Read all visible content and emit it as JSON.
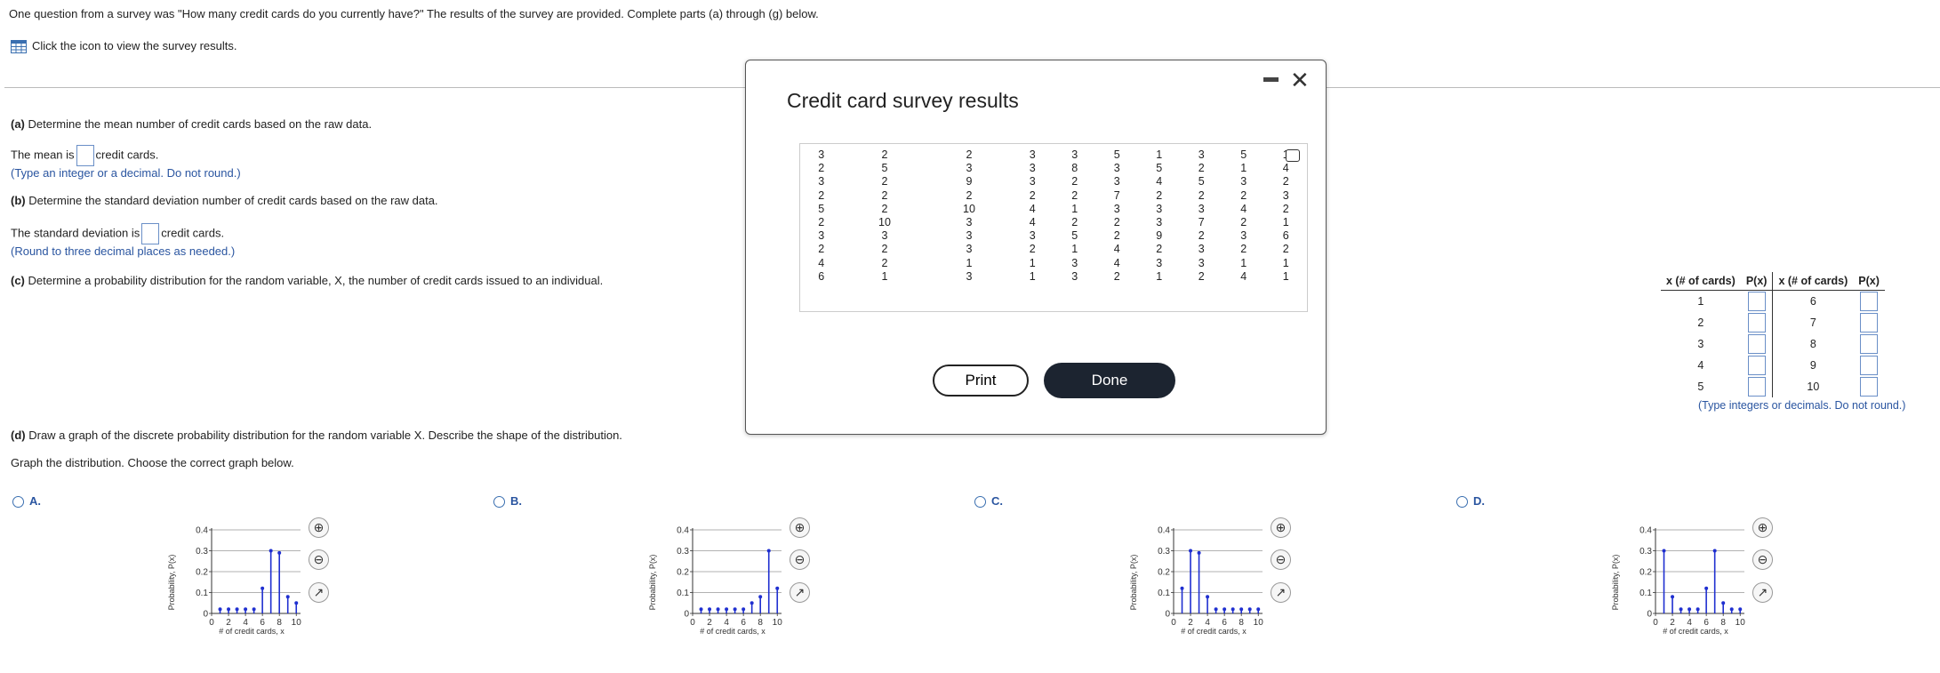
{
  "intro": {
    "question": "One question from a survey was \"How many credit cards do you currently have?\" The results of the survey are provided. Complete parts (a) through (g) below.",
    "icon_prompt": "Click the icon to view the survey results."
  },
  "part_a": {
    "heading_label": "(a)",
    "heading": " Determine the mean number of credit cards based on the raw data.",
    "answer_prefix": "The mean is",
    "answer_suffix": "credit cards.",
    "hint": "(Type an integer or a decimal. Do not round.)"
  },
  "part_b": {
    "heading_label": "(b)",
    "heading": " Determine the standard deviation number of credit cards based on the raw data.",
    "answer_prefix": "The standard deviation is",
    "answer_suffix": "credit cards.",
    "hint": "(Round to three decimal places as needed.)"
  },
  "part_c": {
    "heading_label": "(c)",
    "heading": " Determine a probability distribution for the random variable, X, the number of credit cards issued to an individual."
  },
  "part_d": {
    "heading_label": "(d)",
    "heading": " Draw a graph of the discrete probability distribution for the random variable X. Describe the shape of the distribution.",
    "instruction": "Graph the distribution. Choose the correct graph below."
  },
  "prob_table": {
    "col1": "x (# of cards)",
    "col2": "P(x)",
    "left_x": [
      "1",
      "2",
      "3",
      "4",
      "5"
    ],
    "right_x": [
      "6",
      "7",
      "8",
      "9",
      "10"
    ],
    "hint": "(Type integers or decimals. Do not round.)"
  },
  "modal": {
    "title": "Credit card survey results",
    "print_label": "Print",
    "done_label": "Done",
    "rows": [
      [
        "3",
        "2",
        "2",
        "3",
        "3",
        "5",
        "1",
        "3",
        "5",
        "1"
      ],
      [
        "2",
        "5",
        "3",
        "3",
        "8",
        "3",
        "5",
        "2",
        "1",
        "4"
      ],
      [
        "3",
        "2",
        "9",
        "3",
        "2",
        "3",
        "4",
        "5",
        "3",
        "2"
      ],
      [
        "2",
        "2",
        "2",
        "2",
        "2",
        "7",
        "2",
        "2",
        "2",
        "3"
      ],
      [
        "5",
        "2",
        "10",
        "4",
        "1",
        "3",
        "3",
        "3",
        "4",
        "2"
      ],
      [
        "2",
        "10",
        "3",
        "4",
        "2",
        "2",
        "3",
        "7",
        "2",
        "1"
      ],
      [
        "3",
        "3",
        "3",
        "3",
        "5",
        "2",
        "9",
        "2",
        "3",
        "6"
      ],
      [
        "2",
        "2",
        "3",
        "2",
        "1",
        "4",
        "2",
        "3",
        "2",
        "2"
      ],
      [
        "4",
        "2",
        "1",
        "1",
        "3",
        "4",
        "3",
        "3",
        "1",
        "1"
      ],
      [
        "6",
        "1",
        "3",
        "1",
        "3",
        "2",
        "1",
        "2",
        "4",
        "1"
      ]
    ]
  },
  "graph_common": {
    "y_ticks": [
      "0.4",
      "0.3",
      "0.2",
      "0.1",
      "0"
    ],
    "x_ticks": [
      "0",
      "2",
      "4",
      "6",
      "8",
      "10"
    ],
    "ylabel": "Probability, P(x)",
    "xlabel": "# of credit cards, x"
  },
  "options": [
    {
      "letter": "A.",
      "values": [
        0.02,
        0.02,
        0.02,
        0.02,
        0.02,
        0.12,
        0.3,
        0.29,
        0.08,
        0.05
      ]
    },
    {
      "letter": "B.",
      "values": [
        0.02,
        0.02,
        0.02,
        0.02,
        0.02,
        0.02,
        0.05,
        0.08,
        0.3,
        0.12
      ]
    },
    {
      "letter": "C.",
      "values": [
        0.12,
        0.3,
        0.29,
        0.08,
        0.02,
        0.02,
        0.02,
        0.02,
        0.02,
        0.02
      ]
    },
    {
      "letter": "D.",
      "values": [
        0.3,
        0.08,
        0.02,
        0.02,
        0.02,
        0.12,
        0.3,
        0.05,
        0.02,
        0.02
      ]
    }
  ],
  "colors": {
    "accent": "#2a55a0",
    "bar": "#1f2fd0",
    "done_bg": "#1c2430"
  },
  "icons": [
    "table-icon",
    "close-icon",
    "minimize-icon",
    "copy-icon",
    "zoom-in-icon",
    "zoom-out-icon",
    "popout-icon"
  ]
}
